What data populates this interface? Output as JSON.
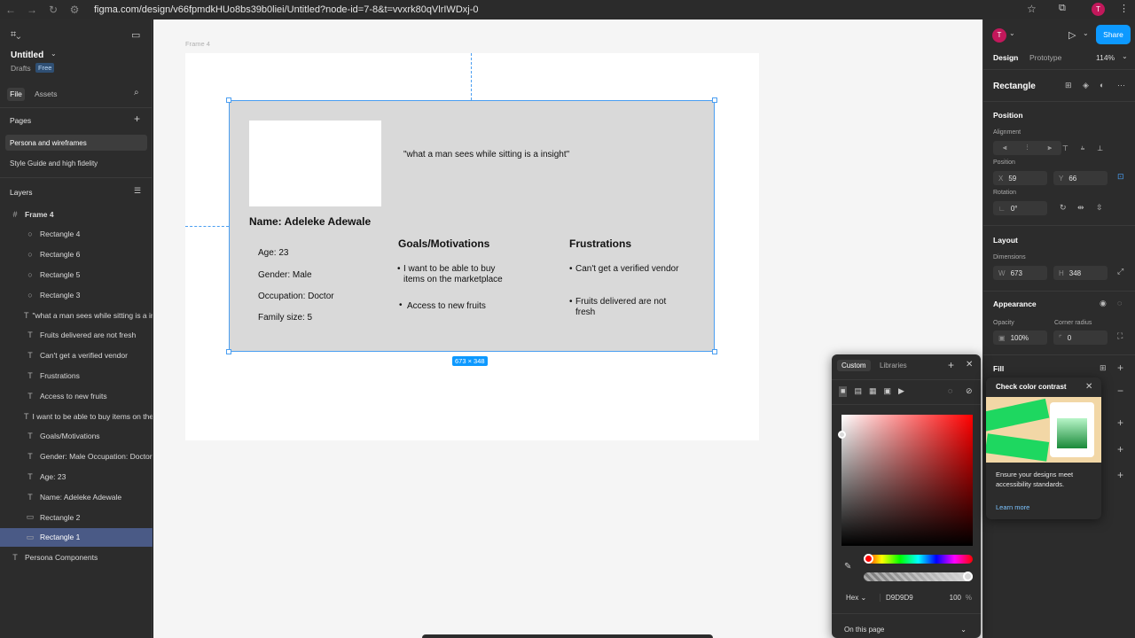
{
  "browser": {
    "url": "figma.com/design/v66fpmdkHUo8bs39b0liei/Untitled?node-id=7-8&t=vvxrk80qVlrIWDxj-0",
    "avatar": "T"
  },
  "left": {
    "file_title": "Untitled",
    "drafts": "Drafts",
    "plan_badge": "Free",
    "tabs": [
      "File",
      "Assets"
    ],
    "pages_label": "Pages",
    "pages": [
      "Persona and wireframes",
      "Style Guide and high fidelity"
    ],
    "layers_label": "Layers",
    "layers": [
      {
        "name": "Frame 4",
        "icon": "#"
      },
      {
        "name": "Rectangle 4",
        "icon": "○"
      },
      {
        "name": "Rectangle 6",
        "icon": "○"
      },
      {
        "name": "Rectangle 5",
        "icon": "○"
      },
      {
        "name": "Rectangle 3",
        "icon": "○"
      },
      {
        "name": "\"what a man sees while sitting is a insight\"",
        "icon": "T"
      },
      {
        "name": "Fruits delivered are not fresh",
        "icon": "T"
      },
      {
        "name": "Can't get a verified vendor",
        "icon": "T"
      },
      {
        "name": "Frustrations",
        "icon": "T"
      },
      {
        "name": "Access to new fruits",
        "icon": "T"
      },
      {
        "name": "I want to be able to buy items on the marketplace",
        "icon": "T"
      },
      {
        "name": "Goals/Motivations",
        "icon": "T"
      },
      {
        "name": "Gender: Male Occupation: Doctor",
        "icon": "T"
      },
      {
        "name": "Age: 23",
        "icon": "T"
      },
      {
        "name": "Name: Adeleke Adewale",
        "icon": "T"
      },
      {
        "name": "Rectangle 2",
        "icon": "▭"
      },
      {
        "name": "Rectangle 1",
        "icon": "▭"
      },
      {
        "name": "Persona Components",
        "icon": "T"
      }
    ]
  },
  "canvas": {
    "frame_label": "Frame 4",
    "quote": "\"what a man sees while sitting is a insight\"",
    "name": "Name: Adeleke Adewale",
    "age": "Age: 23",
    "gender": "Gender: Male",
    "occupation": "Occupation: Doctor",
    "family": "Family size: 5",
    "goals_title": "Goals/Motivations",
    "goal1": "I want to be able to buy items on the marketplace",
    "goal2": "Access to new fruits",
    "frus_title": "Frustrations",
    "frus1": "Can't get a verified vendor",
    "frus2": "Fruits delivered are not fresh",
    "size_badge": "673 × 348"
  },
  "right": {
    "tabs": [
      "Design",
      "Prototype"
    ],
    "zoom": "114%",
    "share": "Share",
    "avatar": "T",
    "selection": "Rectangle",
    "position": "Position",
    "alignment": "Alignment",
    "position_sub": "Position",
    "x": "59",
    "y": "66",
    "rotation_label": "Rotation",
    "rotation": "0°",
    "layout": "Layout",
    "dimensions": "Dimensions",
    "w": "673",
    "h": "348",
    "appearance": "Appearance",
    "opacity_label": "Opacity",
    "opacity": "100%",
    "radius_label": "Corner radius",
    "radius": "0",
    "fill": "Fill"
  },
  "picker": {
    "tabs": [
      "Custom",
      "Libraries"
    ],
    "format": "Hex",
    "hex": "D9D9D9",
    "alpha": "100",
    "pct": "%",
    "scope": "On this page"
  },
  "popover": {
    "title": "Check color contrast",
    "body": "Ensure your designs meet accessibility standards.",
    "link": "Learn more"
  },
  "colors": {
    "accent": "#0d99ff",
    "selection": "#4a9ef1",
    "fill": "#d9d9d9"
  }
}
